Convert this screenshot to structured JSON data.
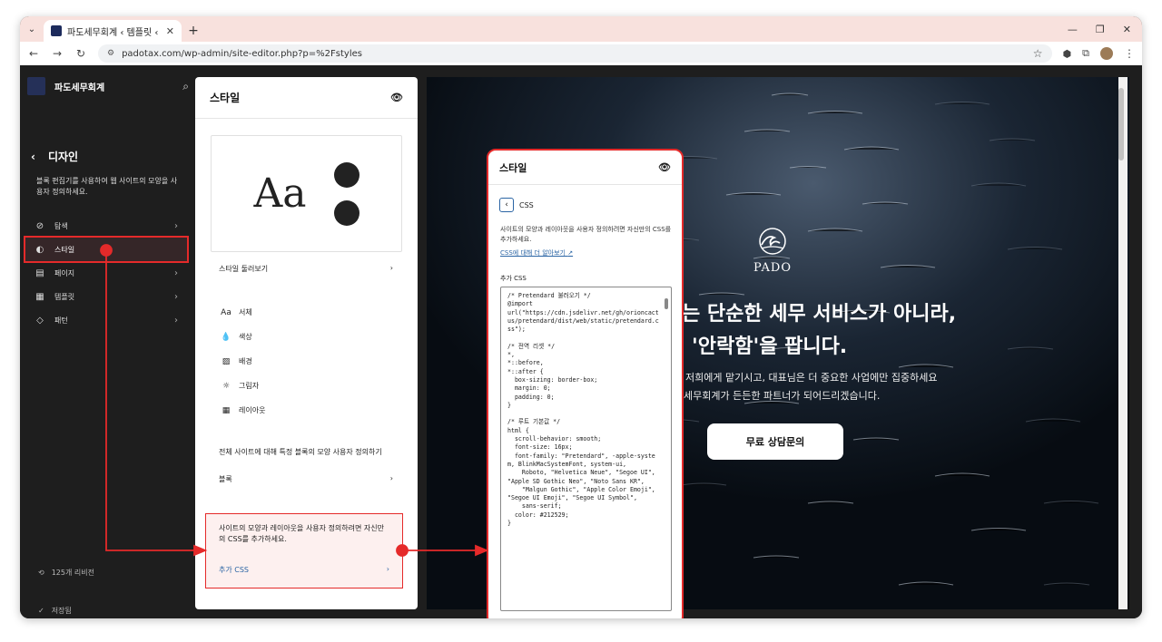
{
  "browser": {
    "tab_title": "파도세무회계 ‹ 템플릿 ‹ 파도세",
    "url": "padotax.com/wp-admin/site-editor.php?p=%2Fstyles"
  },
  "sidebar": {
    "site_name": "파도세무회계",
    "section_title": "디자인",
    "description": "블록 편집기를 사용하여 웹 사이트의 모양을 사용자 정의하세요.",
    "items": [
      {
        "label": "탐색",
        "icon": "compass-icon"
      },
      {
        "label": "스타일",
        "icon": "half-circle-icon"
      },
      {
        "label": "페이지",
        "icon": "page-icon"
      },
      {
        "label": "템플릿",
        "icon": "layout-icon"
      },
      {
        "label": "패턴",
        "icon": "diamond-icon"
      }
    ],
    "revisions": "125개 리비전",
    "saved": "저장됨"
  },
  "styles_panel": {
    "title": "스타일",
    "preview_text": "Aa",
    "browse_label": "스타일 둘러보기",
    "properties": [
      {
        "label": "서체",
        "icon": "typography-icon"
      },
      {
        "label": "색상",
        "icon": "color-drop-icon"
      },
      {
        "label": "배경",
        "icon": "background-icon"
      },
      {
        "label": "그림자",
        "icon": "shadow-icon"
      },
      {
        "label": "레이아웃",
        "icon": "layout-icon"
      }
    ],
    "blocks_desc": "전체 사이트에 대해 특정 블록의 모양 사용자 정의하기",
    "blocks_label": "블록",
    "css_desc": "사이트의 모양과 레이아웃을 사용자 정의하려면 자신만의 CSS를 추가하세요.",
    "css_add": "추가 CSS"
  },
  "css_popup": {
    "title": "스타일",
    "back_label": "CSS",
    "desc": "사이트의 모양과 레이아웃을 사용자 정의하려면 자신만의 CSS를 추가하세요.",
    "link": "CSS에 대해 더 알아보기",
    "label": "추가 CSS",
    "code": "/* Pretendard 불러오기 */\n@import\nurl(\"https://cdn.jsdelivr.net/gh/orioncactus/pretendard/dist/web/static/pretendard.css\");\n\n/* 전역 리셋 */\n*,\n*::before,\n*::after {\n  box-sizing: border-box;\n  margin: 0;\n  padding: 0;\n}\n\n/* 루트 기본값 */\nhtml {\n  scroll-behavior: smooth;\n  font-size: 16px;\n  font-family: \"Pretendard\", -apple-system, BlinkMacSystemFont, system-ui,\n    Roboto, \"Helvetica Neue\", \"Segoe UI\", \"Apple SD Gothic Neo\", \"Noto Sans KR\",\n    \"Malgun Gothic\", \"Apple Color Emoji\", \"Segoe UI Emoji\", \"Segoe UI Symbol\",\n    sans-serif;\n  color: #212529;\n}"
  },
  "site_preview": {
    "logo_text": "PADO",
    "headline_1": "는 단순한 세무 서비스가 아니라,",
    "headline_2": "'안락함'을 팝니다.",
    "sub_1": "저희에게 맡기시고, 대표님은 더 중요한 사업에만 집중하세요",
    "sub_2": "세무회계가 든든한 파트너가 되어드리겠습니다.",
    "cta": "무료 상담문의"
  },
  "colors": {
    "highlight": "#e52a2a",
    "sidebar_bg": "#1e1e1e",
    "link": "#2a64a4"
  }
}
